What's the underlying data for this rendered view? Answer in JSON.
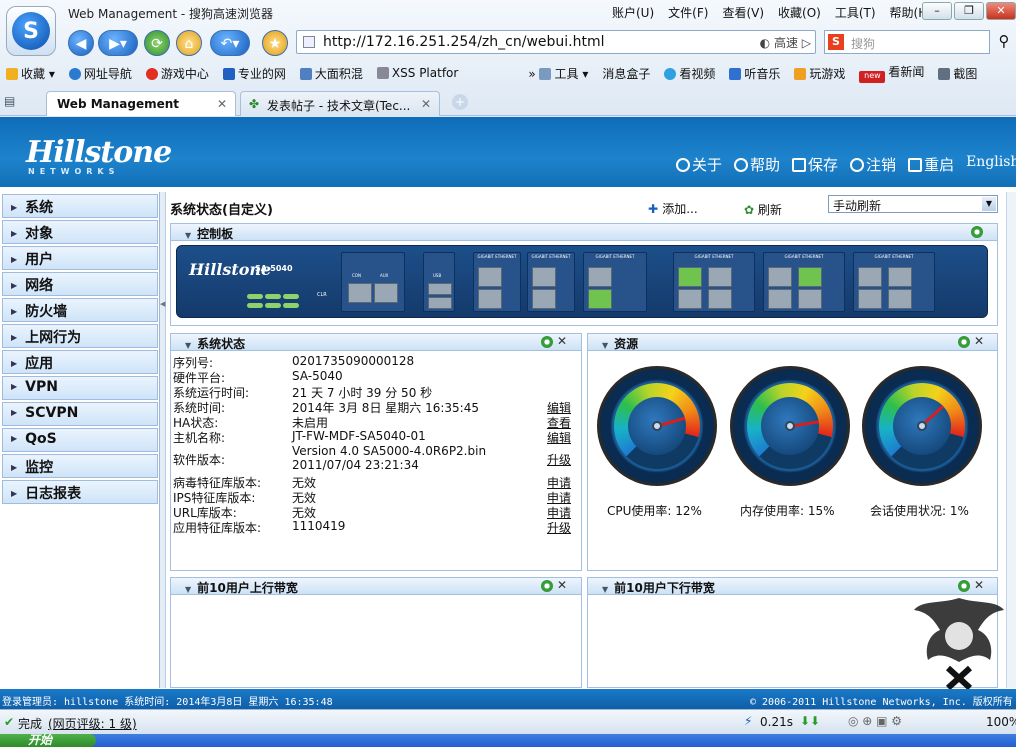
{
  "browser": {
    "window_title": "Web Management - 搜狗高速浏览器",
    "menu": [
      "账户(U)",
      "文件(F)",
      "查看(V)",
      "收藏(O)",
      "工具(T)",
      "帮助(H)"
    ],
    "url": "http://172.16.251.254/zh_cn/webui.html",
    "speed_mode": "高速",
    "search_placeholder": "搜狗",
    "bookmarks": [
      "收藏",
      "网址导航",
      "游戏中心",
      "专业的网",
      "大面积混",
      "XSS Platfor",
      "工具",
      "消息盒子",
      "看视频",
      "听音乐",
      "玩游戏",
      "new",
      "看新闻",
      "截图"
    ],
    "tabs": [
      {
        "label": "Web Management"
      },
      {
        "label": "发表帖子 - 技术文章(Tec..."
      }
    ],
    "status": {
      "done": "完成",
      "rating": "(网页评级: 1 级)",
      "time": "0.21s",
      "zoom": "100%"
    },
    "taskbar": {
      "start": "开始"
    }
  },
  "app": {
    "brand": "Hillstone",
    "brand_sub": "NETWORKS",
    "header_links": [
      "关于",
      "帮助",
      "保存",
      "注销",
      "重启",
      "English"
    ],
    "sidebar": [
      "系统",
      "对象",
      "用户",
      "网络",
      "防火墙",
      "上网行为",
      "应用",
      "VPN",
      "SCVPN",
      "QoS",
      "监控",
      "日志报表"
    ],
    "page_title": "系统状态(自定义)",
    "add_label": "添加...",
    "refresh_label": "刷新",
    "refresh_mode": "手动刷新",
    "panels": {
      "control": "控制板",
      "status": "系统状态",
      "resource": "资源",
      "upload": "前10用户上行带宽",
      "download": "前10用户下行带宽"
    },
    "device": {
      "brand": "Hillstone",
      "model": "SA-5040",
      "group_label": "GIGABIT ETHERNET",
      "con": "CON",
      "aux": "AUX",
      "usb": "USB",
      "clr": "CLR",
      "leds": [
        "PWR",
        "ALM",
        "PS0",
        "STA",
        "HA",
        "PS1"
      ]
    },
    "status_rows": [
      {
        "label": "序列号:",
        "value": "0201735090000128",
        "link": ""
      },
      {
        "label": "硬件平台:",
        "value": "SA-5040",
        "link": ""
      },
      {
        "label": "系统运行时间:",
        "value": "21 天 7 小时 39 分 50 秒",
        "link": ""
      },
      {
        "label": "系统时间:",
        "value": "2014年  3月 8日  星期六  16:35:45",
        "link": "编辑"
      },
      {
        "label": "HA状态:",
        "value": "未启用",
        "link": "查看"
      },
      {
        "label": "主机名称:",
        "value": "JT-FW-MDF-SA5040-01",
        "link": "编辑"
      },
      {
        "label": "软件版本:",
        "value": "Version 4.0 SA5000-4.0R6P2.bin",
        "value2": "2011/07/04 23:21:34",
        "link": "升级"
      },
      {
        "label": "病毒特征库版本:",
        "value": "无效",
        "link": "申请"
      },
      {
        "label": "IPS特征库版本:",
        "value": "无效",
        "link": "申请"
      },
      {
        "label": "URL库版本:",
        "value": "无效",
        "link": "申请"
      },
      {
        "label": "应用特征库版本:",
        "value": "1110419",
        "link": "升级"
      }
    ],
    "gauges": [
      {
        "label": "CPU使用率: 12%",
        "percent": 12
      },
      {
        "label": "内存使用率: 15%",
        "percent": 15
      },
      {
        "label": "会话使用状况: 1%",
        "percent": 1
      }
    ],
    "footer_left": "登录管理员: hillstone  系统时间: 2014年3月8日 星期六 16:35:48",
    "footer_right": "© 2006-2011 Hillstone Networks, Inc. 版权所有"
  },
  "colors": {
    "header": "#1d83cc",
    "panel": "#cde2f6"
  }
}
